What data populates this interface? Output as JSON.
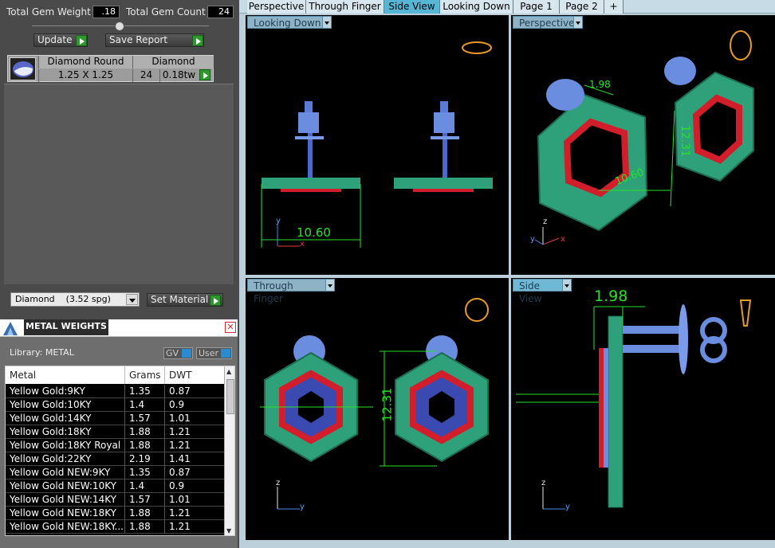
{
  "gem_summary": {
    "total_weight_label": "Total Gem Weight",
    "total_weight_value": ".18",
    "total_count_label": "Total Gem Count",
    "total_count_value": "24"
  },
  "toolbar": {
    "update_label": "Update",
    "save_report_label": "Save Report"
  },
  "gem_row": {
    "name": "Diamond Round",
    "size": "1.25 X 1.25",
    "material": "Diamond",
    "count": "24",
    "weight": "0.18tw"
  },
  "material_select": {
    "value": "Diamond    (3.52 spg)",
    "set_material_label": "Set Material"
  },
  "metal_weights": {
    "title": "METAL WEIGHTS",
    "library": "Library: METAL",
    "gv_label": "GV",
    "user_label": "User",
    "columns": [
      "Metal",
      "Grams",
      "DWT"
    ],
    "rows": [
      [
        "Yellow Gold:9KY",
        "1.35",
        "0.87"
      ],
      [
        "Yellow Gold:10KY",
        "1.4",
        "0.9"
      ],
      [
        "Yellow Gold:14KY",
        "1.57",
        "1.01"
      ],
      [
        "Yellow Gold:18KY",
        "1.88",
        "1.21"
      ],
      [
        "Yellow Gold:18KY Royal",
        "1.88",
        "1.21"
      ],
      [
        "Yellow Gold:22KY",
        "2.19",
        "1.41"
      ],
      [
        "Yellow Gold NEW:9KY",
        "1.35",
        "0.87"
      ],
      [
        "Yellow Gold NEW:10KY",
        "1.4",
        "0.9"
      ],
      [
        "Yellow Gold NEW:14KY",
        "1.57",
        "1.01"
      ],
      [
        "Yellow Gold NEW:18KY",
        "1.88",
        "1.21"
      ],
      [
        "Yellow Gold NEW:18KY...",
        "1.88",
        "1.21"
      ]
    ]
  },
  "tabs": [
    "Perspective",
    "Through Finger",
    "Side View",
    "Looking Down",
    "Page 1",
    "Page 2",
    "+"
  ],
  "active_tab": "Side View",
  "viewports": {
    "top_left": {
      "title": "Looking Down",
      "dimension": "10.60"
    },
    "top_right": {
      "title": "Perspective",
      "dim_a": "1.98",
      "dim_b": "12.31",
      "dim_c": "10.60"
    },
    "bottom_left": {
      "title": "Through Finger",
      "dimension": "12.31"
    },
    "bottom_right": {
      "title": "Side View",
      "dimension": "1.98"
    }
  },
  "axes": {
    "x": "x",
    "y": "y",
    "z": "z"
  },
  "colors": {
    "metal": "#2ea07a",
    "gem": "#a8b4ff",
    "prong": "#d21e2a",
    "dimension": "#29e329",
    "active_tab": "#57b6d6"
  }
}
